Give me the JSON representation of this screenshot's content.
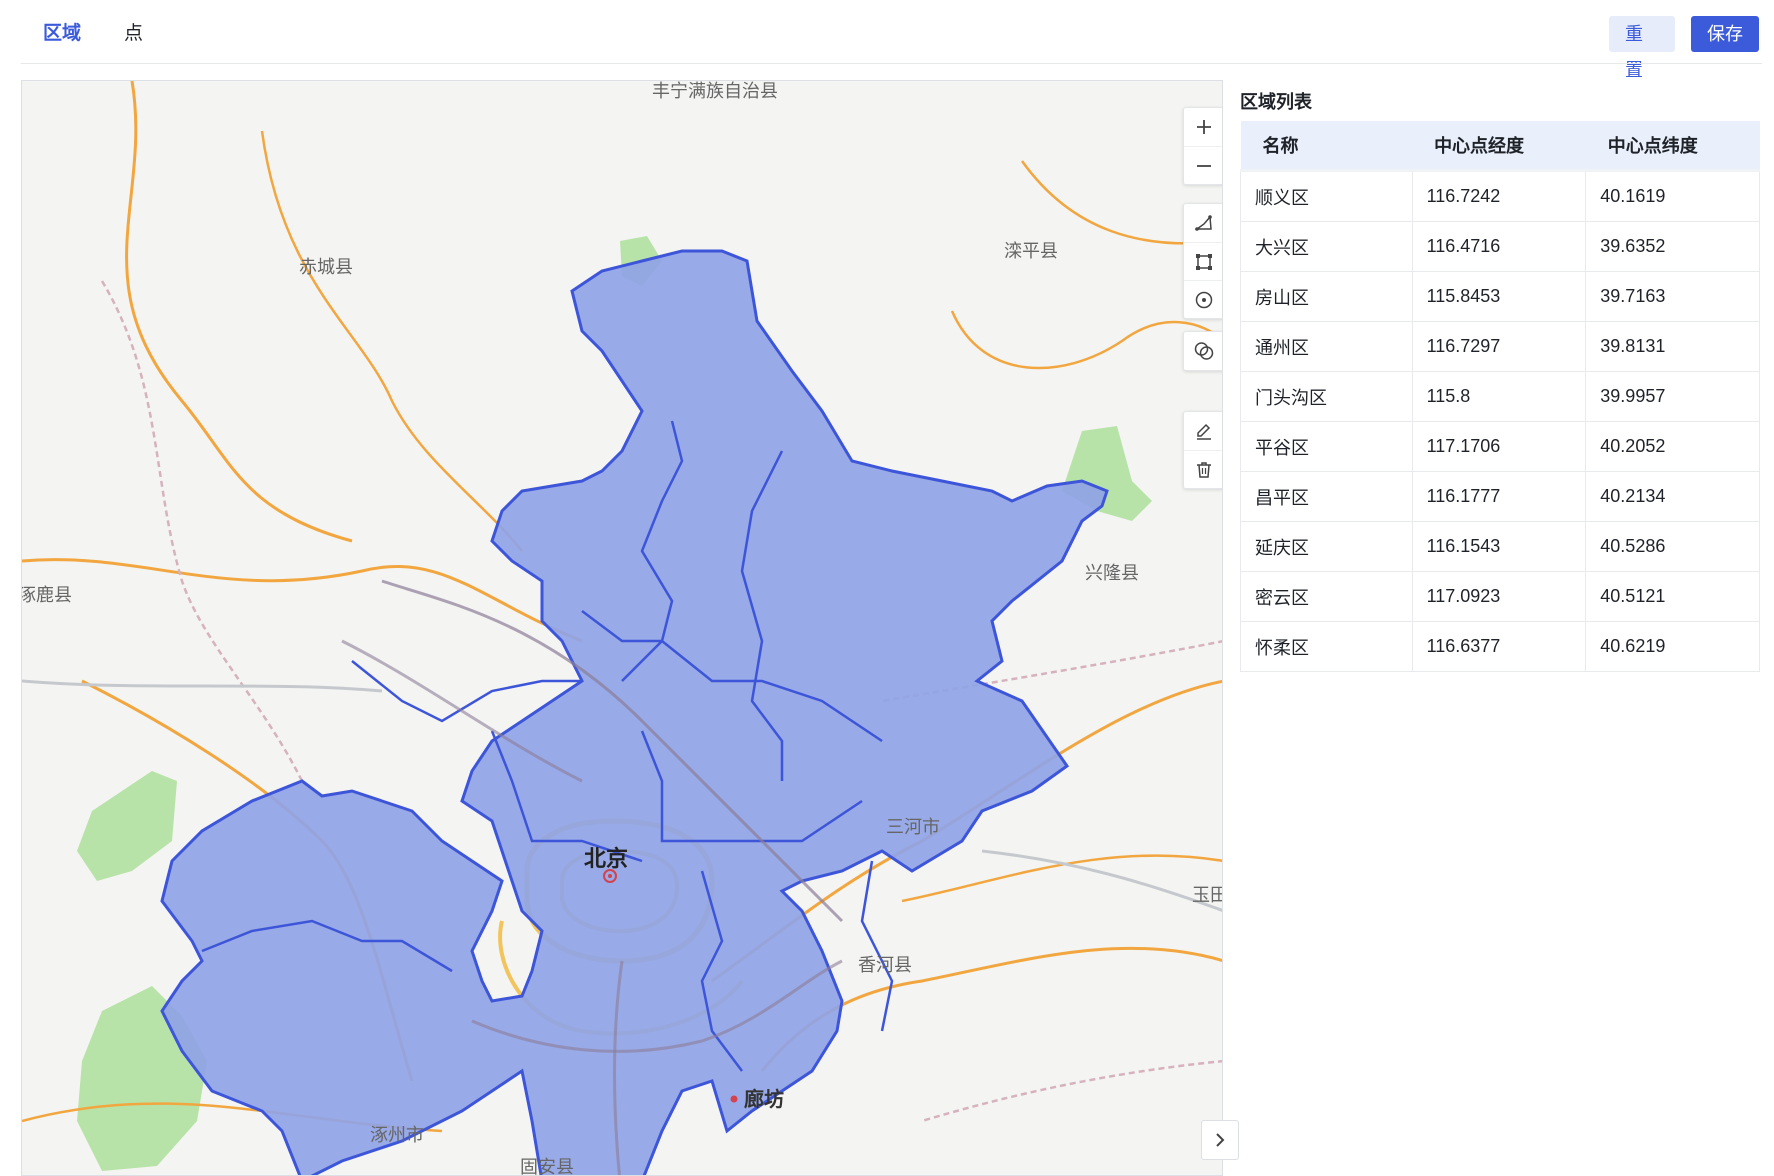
{
  "toolbar": {
    "tabs": [
      {
        "label": "区域",
        "active": true
      },
      {
        "label": "点",
        "active": false
      }
    ],
    "reset_label": "重置",
    "save_label": "保存"
  },
  "colors": {
    "accent": "#3b5bdb",
    "region_fill": "#8fa3e6",
    "region_stroke": "#3d55d9"
  },
  "map": {
    "labels": {
      "top_county": "丰宁满族自治县",
      "chicheng": "赤城县",
      "luanping": "滦平县",
      "xinglong": "兴隆县",
      "zhuolu": "涿鹿县",
      "sanhe": "三河市",
      "yutian": "玉田",
      "xianghe": "香河县",
      "langfang": "廊坊",
      "zhuozhou": "涿州市",
      "guan": "固安县",
      "beijing": "北京"
    },
    "controls": {
      "zoom_in": "zoom-in",
      "zoom_out": "zoom-out",
      "draw_polyline": "draw-polyline",
      "draw_rectangle": "draw-rectangle",
      "draw_circle": "draw-circle",
      "overlap": "overlap",
      "edit": "edit",
      "delete": "delete"
    }
  },
  "side_panel": {
    "title": "区域列表",
    "columns": [
      "名称",
      "中心点经度",
      "中心点纬度"
    ],
    "rows": [
      {
        "name": "顺义区",
        "lng": "116.7242",
        "lat": "40.1619"
      },
      {
        "name": "大兴区",
        "lng": "116.4716",
        "lat": "39.6352"
      },
      {
        "name": "房山区",
        "lng": "115.8453",
        "lat": "39.7163"
      },
      {
        "name": "通州区",
        "lng": "116.7297",
        "lat": "39.8131"
      },
      {
        "name": "门头沟区",
        "lng": "115.8",
        "lat": "39.9957"
      },
      {
        "name": "平谷区",
        "lng": "117.1706",
        "lat": "40.2052"
      },
      {
        "name": "昌平区",
        "lng": "116.1777",
        "lat": "40.2134"
      },
      {
        "name": "延庆区",
        "lng": "116.1543",
        "lat": "40.5286"
      },
      {
        "name": "密云区",
        "lng": "117.0923",
        "lat": "40.5121"
      },
      {
        "name": "怀柔区",
        "lng": "116.6377",
        "lat": "40.6219"
      }
    ]
  }
}
